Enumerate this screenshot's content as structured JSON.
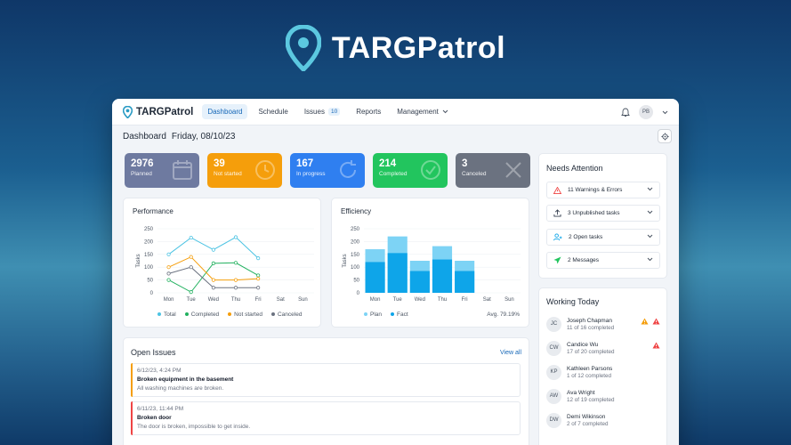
{
  "brand": {
    "name": "TARGPatrol",
    "color": "#5cc8e0"
  },
  "nav": {
    "logo": "TARGPatrol",
    "items": [
      {
        "label": "Dashboard",
        "active": true
      },
      {
        "label": "Schedule"
      },
      {
        "label": "Issues",
        "count": "10"
      },
      {
        "label": "Reports"
      },
      {
        "label": "Management"
      }
    ],
    "user_initials": "PB"
  },
  "header": {
    "title": "Dashboard",
    "date": "Friday, 08/10/23"
  },
  "stats": [
    {
      "value": "2976",
      "label": "Planned",
      "color": "#6e7aa0",
      "icon": "calendar-icon"
    },
    {
      "value": "39",
      "label": "Not started",
      "color": "#f59e0b",
      "icon": "clock-icon"
    },
    {
      "value": "167",
      "label": "In progress",
      "color": "#2f7ff0",
      "icon": "refresh-icon"
    },
    {
      "value": "214",
      "label": "Completed",
      "color": "#22c55e",
      "icon": "check-circle-icon"
    },
    {
      "value": "3",
      "label": "Canceled",
      "color": "#6b7280",
      "icon": "x-icon"
    }
  ],
  "performance": {
    "title": "Performance",
    "legend": [
      "Total",
      "Completed",
      "Not started",
      "Canceled"
    ]
  },
  "efficiency": {
    "title": "Efficiency",
    "legend": [
      "Plan",
      "Fact"
    ],
    "avg_label": "Avg. 79.19%"
  },
  "chart_data": [
    {
      "type": "line",
      "title": "Performance",
      "xlabel": "",
      "ylabel": "Tasks",
      "categories": [
        "Mon",
        "Tue",
        "Wed",
        "Thu",
        "Fri",
        "Sat",
        "Sun"
      ],
      "ylim": [
        0,
        250
      ],
      "yticks": [
        0,
        50,
        100,
        150,
        200,
        250
      ],
      "series": [
        {
          "name": "Total",
          "color": "#4cc3e3",
          "values": [
            150,
            215,
            168,
            217,
            135,
            null,
            null
          ]
        },
        {
          "name": "Completed",
          "color": "#22b15f",
          "values": [
            50,
            3,
            115,
            117,
            68,
            null,
            null
          ]
        },
        {
          "name": "Not started",
          "color": "#f59e0b",
          "values": [
            100,
            140,
            50,
            50,
            55,
            null,
            null
          ]
        },
        {
          "name": "Canceled",
          "color": "#6b7280",
          "values": [
            75,
            100,
            20,
            20,
            20,
            null,
            null
          ]
        }
      ]
    },
    {
      "type": "bar",
      "title": "Efficiency",
      "xlabel": "",
      "ylabel": "Tasks",
      "categories": [
        "Mon",
        "Tue",
        "Wed",
        "Thu",
        "Fri",
        "Sat",
        "Sun"
      ],
      "ylim": [
        0,
        250
      ],
      "yticks": [
        0,
        50,
        100,
        150,
        200,
        250
      ],
      "series": [
        {
          "name": "Plan",
          "color": "#7dd3f5",
          "values": [
            170,
            220,
            125,
            182,
            125,
            null,
            null
          ]
        },
        {
          "name": "Fact",
          "color": "#0ea5e9",
          "values": [
            120,
            155,
            85,
            130,
            85,
            null,
            null
          ]
        }
      ]
    }
  ],
  "issues": {
    "title": "Open Issues",
    "view_all": "View all",
    "items": [
      {
        "ts": "6/12/23, 4:24 PM",
        "title": "Broken equipment in the basement",
        "desc": "All washing machines are broken.",
        "color": "#f59e0b"
      },
      {
        "ts": "6/11/23, 11:44 PM",
        "title": "Broken door",
        "desc": "The door is broken, impossible to get inside.",
        "color": "#ef4444"
      }
    ]
  },
  "attention": {
    "title": "Needs Attention",
    "items": [
      {
        "label": "11 Warnings & Errors",
        "icon": "warning-icon",
        "color": "#ef4444"
      },
      {
        "label": "3 Unpublished tasks",
        "icon": "upload-icon",
        "color": "#374151"
      },
      {
        "label": "2 Open tasks",
        "icon": "user-add-icon",
        "color": "#0ea5e9"
      },
      {
        "label": "2 Messages",
        "icon": "send-icon",
        "color": "#22c55e"
      }
    ]
  },
  "working": {
    "title": "Working Today",
    "people": [
      {
        "initials": "JC",
        "name": "Joseph Chapman",
        "progress": "11 of 16 completed",
        "flags": [
          "warning",
          "error"
        ]
      },
      {
        "initials": "CW",
        "name": "Candice Wu",
        "progress": "17 of 20 completed",
        "flags": [
          "error"
        ]
      },
      {
        "initials": "KP",
        "name": "Kathleen Parsons",
        "progress": "1 of 12 completed",
        "flags": []
      },
      {
        "initials": "AW",
        "name": "Ava Wright",
        "progress": "12 of 19 completed",
        "flags": []
      },
      {
        "initials": "DW",
        "name": "Demi Wikinson",
        "progress": "2 of 7 completed",
        "flags": []
      }
    ]
  }
}
